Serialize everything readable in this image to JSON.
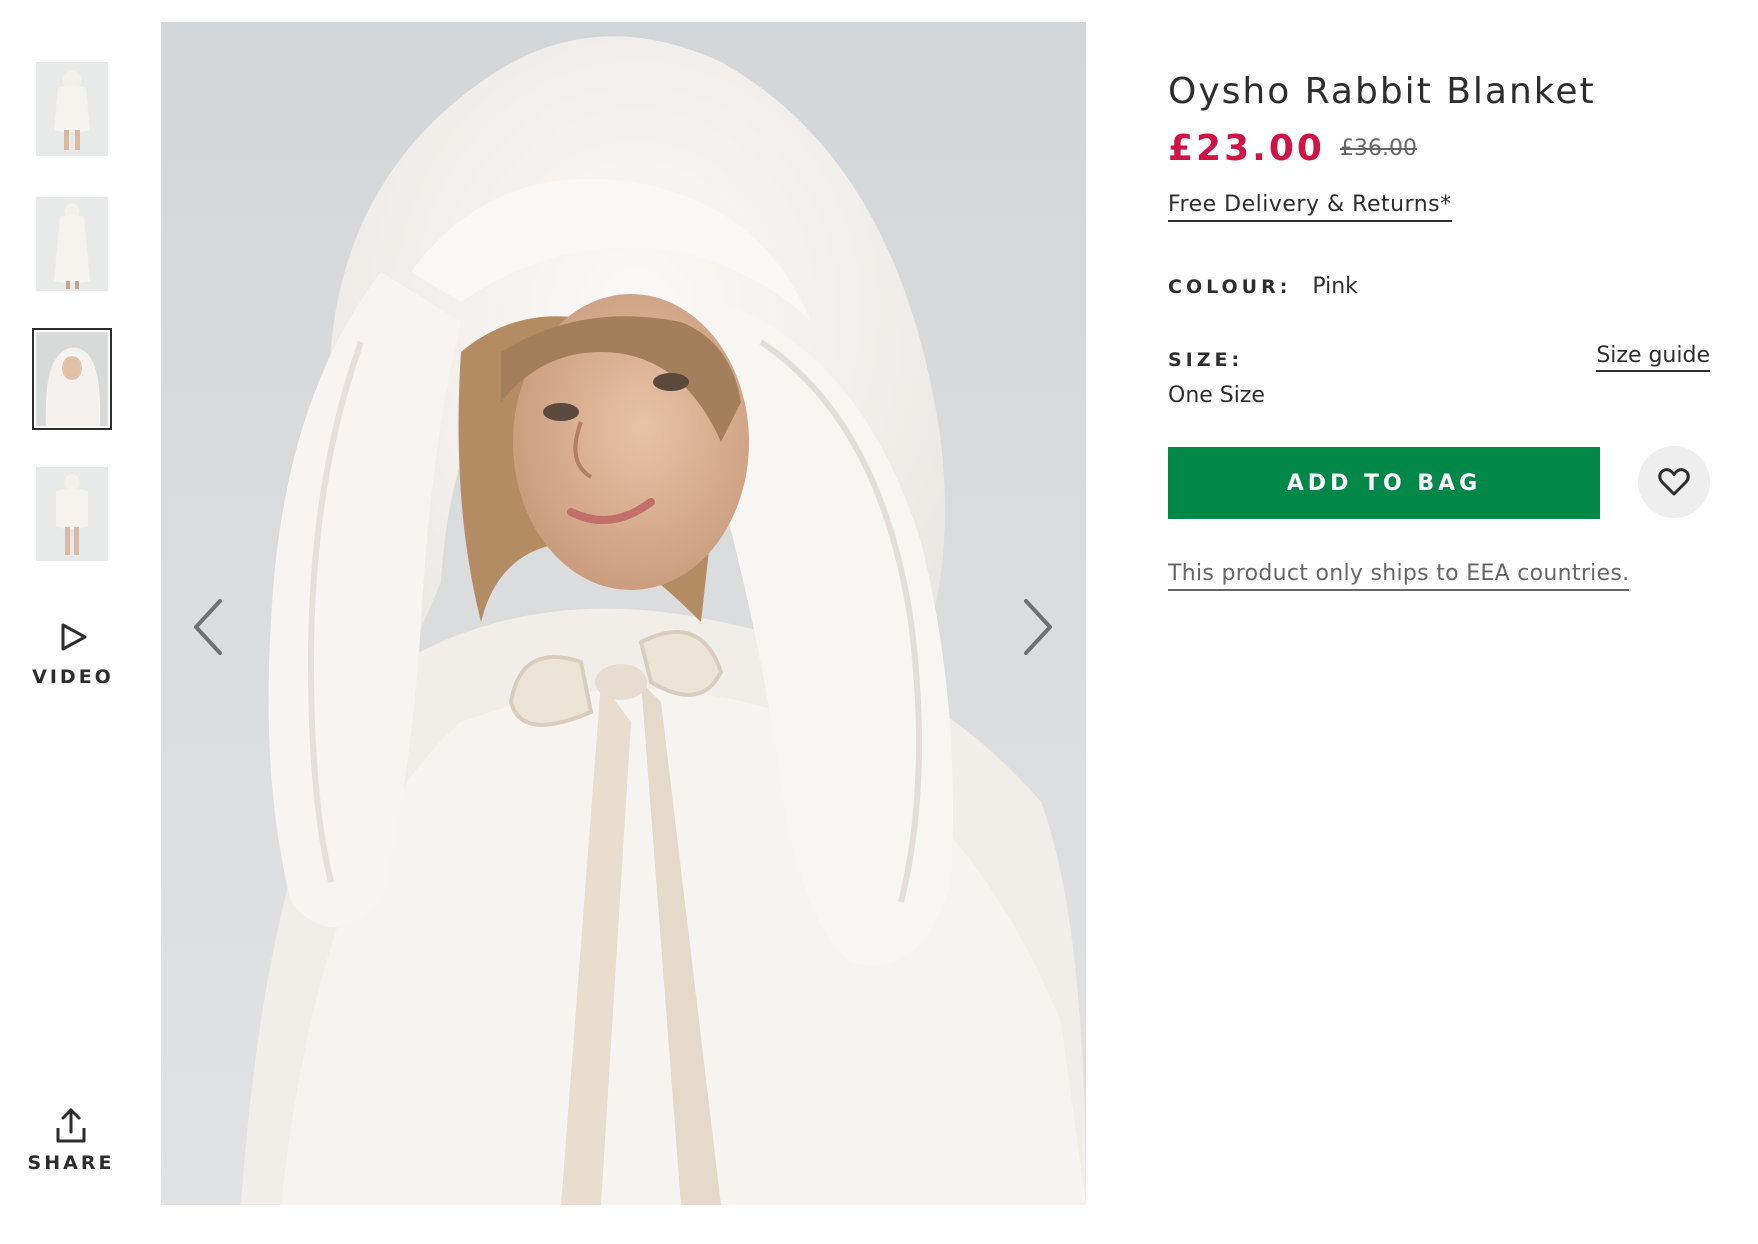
{
  "gallery": {
    "thumbnails": [
      {
        "label": "thumbnail-1",
        "selected": false
      },
      {
        "label": "thumbnail-2",
        "selected": false
      },
      {
        "label": "thumbnail-3",
        "selected": true
      },
      {
        "label": "thumbnail-4",
        "selected": false
      }
    ],
    "video_label": "VIDEO",
    "share_label": "SHARE"
  },
  "product": {
    "title": "Oysho Rabbit Blanket",
    "price_now": "£23.00",
    "price_was": "£36.00",
    "delivery_link": "Free Delivery & Returns*",
    "colour_label": "COLOUR:",
    "colour_value": "Pink",
    "size_label": "SIZE:",
    "size_guide": "Size guide",
    "size_value": "One Size",
    "add_to_bag": "ADD TO BAG",
    "ships_note": "This product only ships to EEA countries."
  },
  "colors": {
    "price_sale": "#d01345",
    "add_to_bag": "#018849",
    "text": "#2d2d2d",
    "wishlist_bg": "#eeeeee"
  },
  "icons": {
    "prev": "chevron-left-icon",
    "next": "chevron-right-icon",
    "video": "play-icon",
    "share": "share-icon",
    "wishlist": "heart-icon"
  }
}
